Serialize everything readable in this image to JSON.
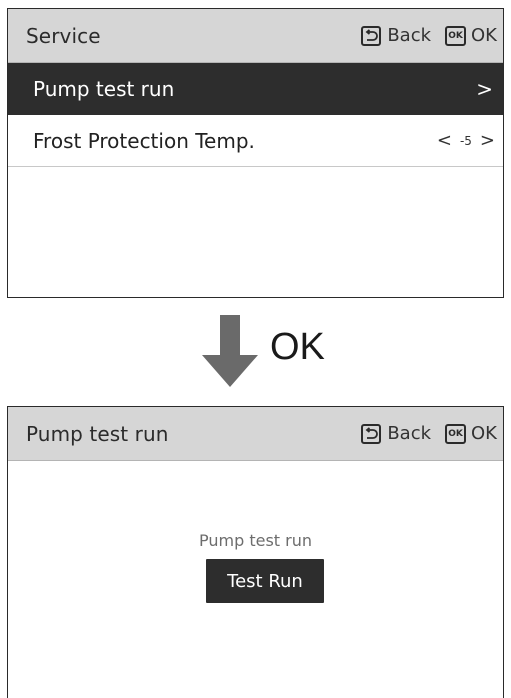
{
  "screen1": {
    "header": {
      "title": "Service",
      "back_label": "Back",
      "ok_icon_text": "OK",
      "ok_label": "OK"
    },
    "rows": [
      {
        "label": "Pump test run",
        "arrow": ">",
        "selected": true
      },
      {
        "label": "Frost Protection Temp.",
        "value": "-5",
        "left": "<",
        "right": ">"
      }
    ]
  },
  "transition": {
    "label": "OK",
    "icon": "down-arrow-icon"
  },
  "screen2": {
    "header": {
      "title": "Pump test run",
      "back_label": "Back",
      "ok_icon_text": "OK",
      "ok_label": "OK"
    },
    "body_label": "Pump test run",
    "button_label": "Test Run"
  },
  "colors": {
    "header_bg": "#d6d6d6",
    "selected_bg": "#2d2d2d",
    "button_bg": "#2d2d2d",
    "arrow": "#6a6a6a"
  }
}
